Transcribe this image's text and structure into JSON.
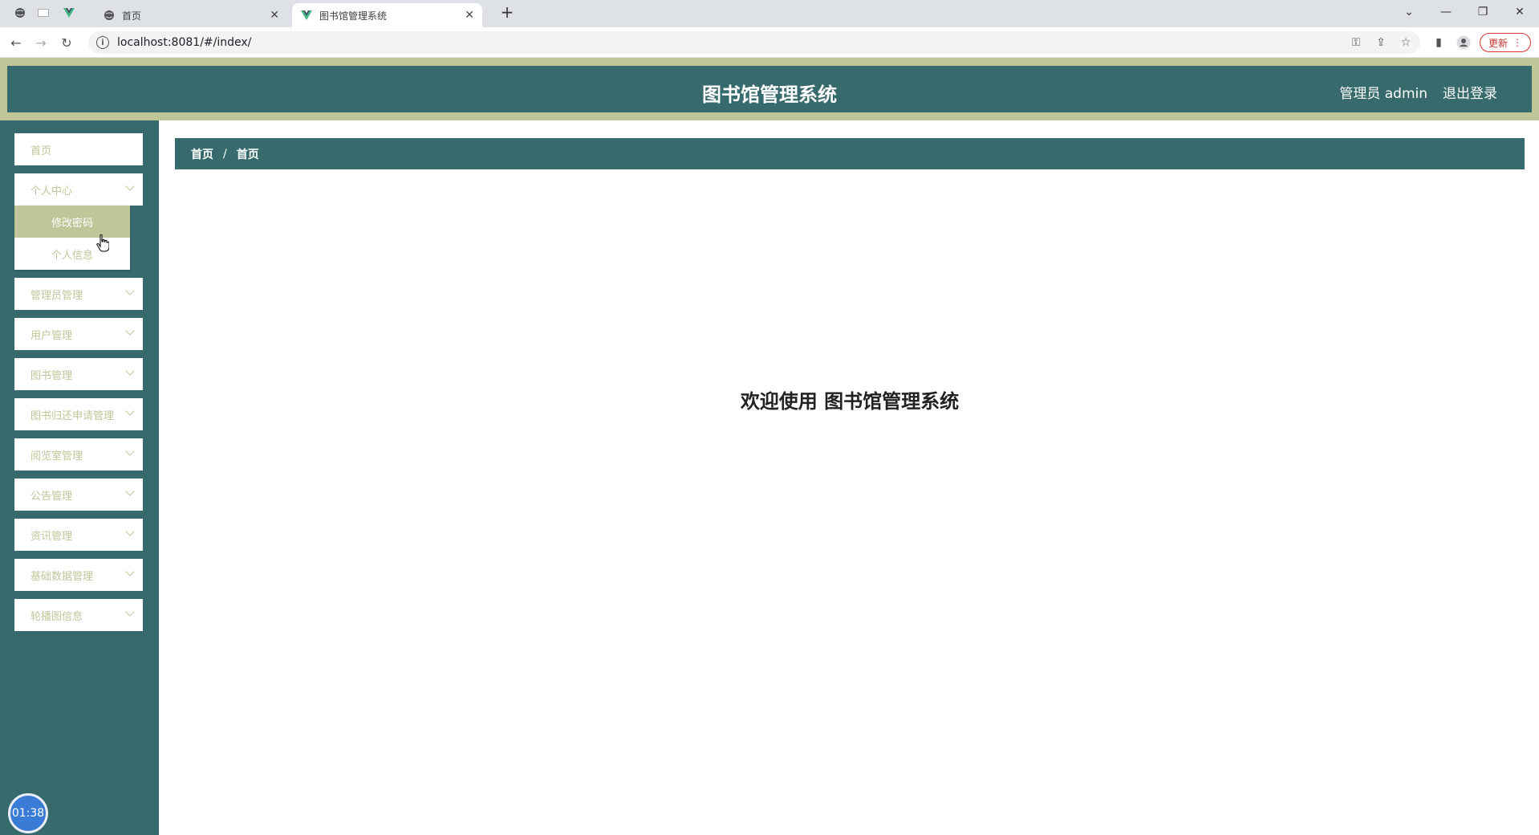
{
  "browser": {
    "tabs": [
      {
        "label": "首页",
        "active": false
      },
      {
        "label": "图书馆管理系统",
        "active": true
      }
    ],
    "url": "localhost:8081/#/index/",
    "update_label": "更新"
  },
  "header": {
    "title": "图书馆管理系统",
    "user_label": "管理员 admin",
    "logout_label": "退出登录"
  },
  "sidebar": {
    "items": [
      {
        "label": "首页",
        "has_children": false
      },
      {
        "label": "个人中心",
        "has_children": true
      },
      {
        "label": "管理员管理",
        "has_children": true
      },
      {
        "label": "用户管理",
        "has_children": true
      },
      {
        "label": "图书管理",
        "has_children": true
      },
      {
        "label": "图书归还申请管理",
        "has_children": true
      },
      {
        "label": "阅览室管理",
        "has_children": true
      },
      {
        "label": "公告管理",
        "has_children": true
      },
      {
        "label": "资讯管理",
        "has_children": true
      },
      {
        "label": "基础数据管理",
        "has_children": true
      },
      {
        "label": "轮播图信息",
        "has_children": true
      }
    ],
    "submenu": [
      {
        "label": "修改密码",
        "active": true
      },
      {
        "label": "个人信息",
        "active": false
      }
    ],
    "timer": "01:38"
  },
  "breadcrumb": {
    "items": [
      "首页",
      "首页"
    ],
    "separator": "/"
  },
  "main": {
    "welcome": "欢迎使用 图书馆管理系统"
  },
  "colors": {
    "primary": "#366a6c",
    "accent": "#c1c699"
  }
}
